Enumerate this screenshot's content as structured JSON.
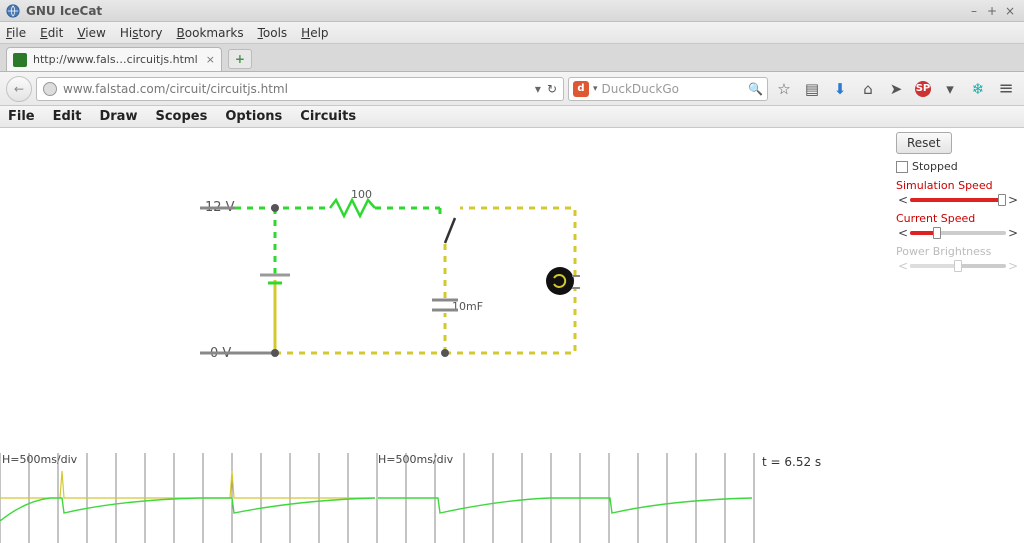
{
  "window": {
    "title": "GNU IceCat",
    "min": "–",
    "max": "+",
    "close": "×"
  },
  "os_menu": {
    "file": "File",
    "edit": "Edit",
    "view": "View",
    "history": "History",
    "bookmarks": "Bookmarks",
    "tools": "Tools",
    "help": "Help"
  },
  "tab": {
    "title": "http://www.fals…circuitjs.html",
    "close": "×",
    "new": "+"
  },
  "urlbar": {
    "back": "←",
    "url": "www.falstad.com/circuit/circuitjs.html",
    "reload": "↻",
    "dropdown": "▾",
    "search_engine": "DuckDuckGo",
    "search_icon": "🔍"
  },
  "toolbar_icons": {
    "star": "☆",
    "library": "▤",
    "download": "⬇",
    "home": "⌂",
    "send": "➤",
    "adblock": "SP",
    "https": "▾",
    "snowflake": "❄",
    "menu": "≡"
  },
  "app_menu": {
    "file": "File",
    "edit": "Edit",
    "draw": "Draw",
    "scopes": "Scopes",
    "options": "Options",
    "circuits": "Circuits"
  },
  "controls": {
    "reset": "Reset",
    "stopped": "Stopped",
    "sim_speed": "Simulation Speed",
    "cur_speed": "Current Speed",
    "pow_bright": "Power Brightness"
  },
  "circuit": {
    "v_high": "12 V",
    "v_low": "0 V",
    "resistor": "100",
    "capacitor": "10mF"
  },
  "scope": {
    "h1": "H=500ms/div",
    "h2": "H=500ms/div",
    "time": "t = 6.52 s"
  }
}
